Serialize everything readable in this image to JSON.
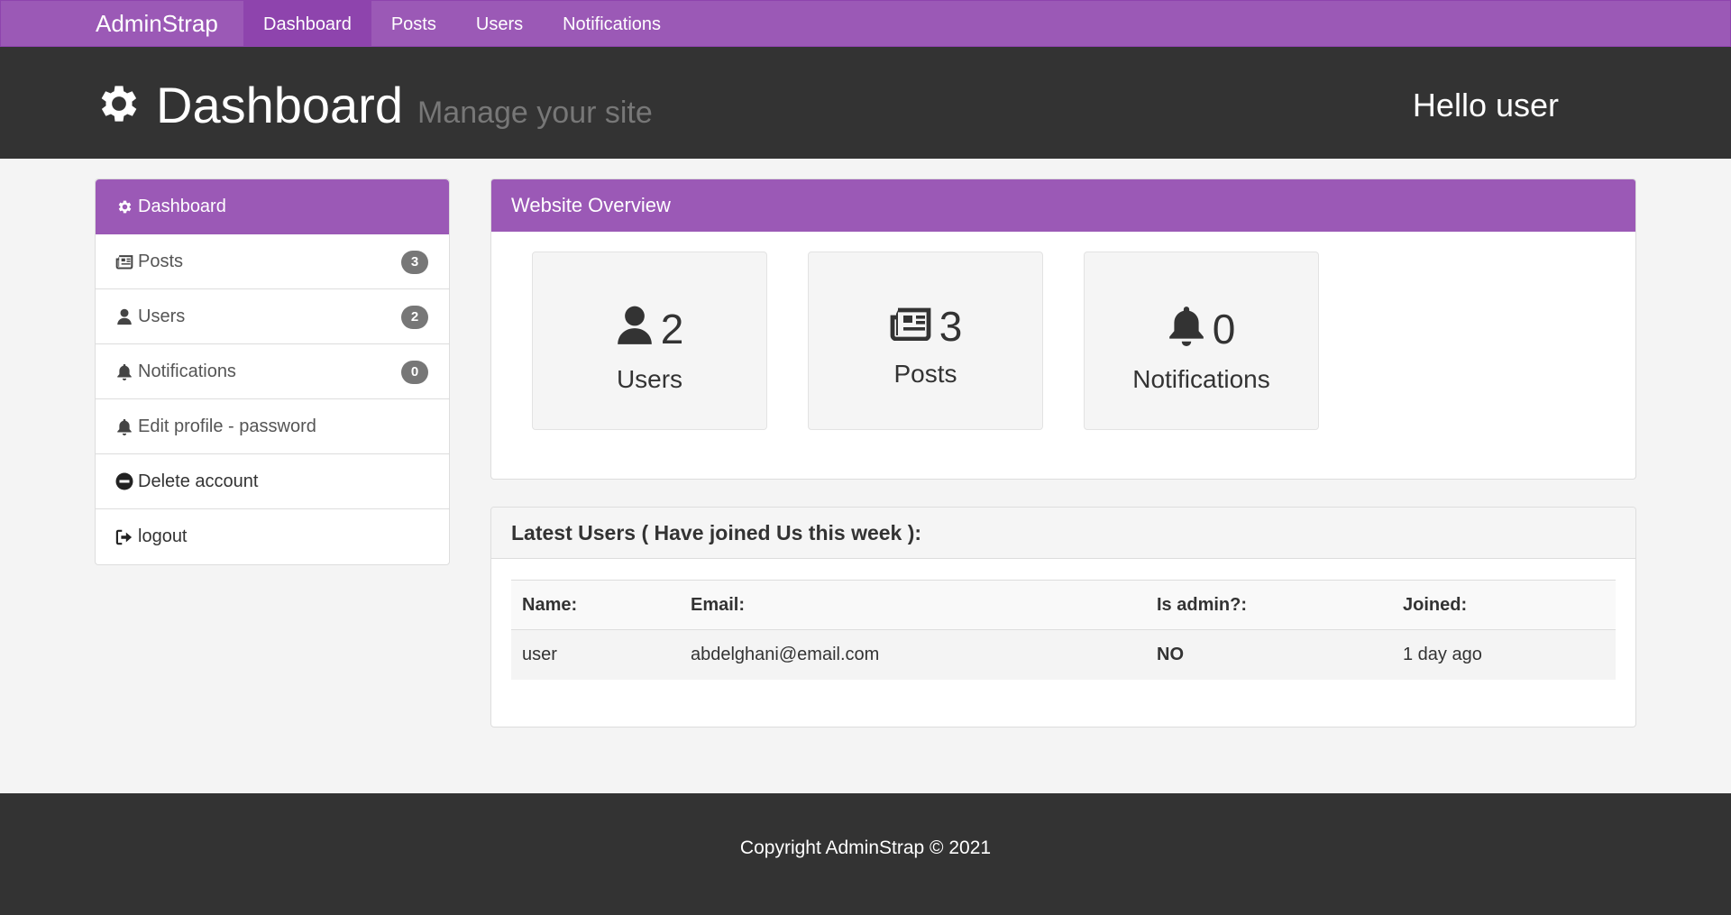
{
  "navbar": {
    "brand": "AdminStrap",
    "items": [
      {
        "label": "Dashboard",
        "active": true
      },
      {
        "label": "Posts"
      },
      {
        "label": "Users"
      },
      {
        "label": "Notifications"
      }
    ]
  },
  "header": {
    "icon": "gear-icon",
    "title": "Dashboard",
    "subtitle": "Manage your site",
    "greeting": "Hello user"
  },
  "sidebar": {
    "items": [
      {
        "label": "Dashboard",
        "icon": "gear-icon",
        "active": true
      },
      {
        "label": "Posts",
        "icon": "newspaper-icon",
        "badge": "3"
      },
      {
        "label": "Users",
        "icon": "user-icon",
        "badge": "2"
      },
      {
        "label": "Notifications",
        "icon": "bell-icon",
        "badge": "0"
      },
      {
        "label": "Edit profile - password",
        "icon": "bell-icon"
      },
      {
        "label": "Delete account",
        "icon": "minus-circle-icon"
      },
      {
        "label": "logout",
        "icon": "sign-out-icon"
      }
    ]
  },
  "overview": {
    "title": "Website Overview",
    "cards": [
      {
        "count": "2",
        "label": "Users",
        "icon": "user-icon"
      },
      {
        "count": "3",
        "label": "Posts",
        "icon": "newspaper-icon"
      },
      {
        "count": "0",
        "label": "Notifications",
        "icon": "bell-icon"
      }
    ]
  },
  "latest_users": {
    "title": "Latest Users ( Have joined Us this week ):",
    "columns": [
      "Name:",
      "Email:",
      "Is admin?:",
      "Joined:"
    ],
    "rows": [
      {
        "name": "user",
        "email": "abdelghani@email.com",
        "is_admin": "NO",
        "joined": "1 day ago"
      }
    ]
  },
  "footer": {
    "text": "Copyright AdminStrap © 2021"
  },
  "colors": {
    "primary": "#9b59b6",
    "primary_dark": "#8e44ad",
    "header_bg": "#333333",
    "page_bg": "#f4f4f4",
    "badge": "#777777"
  }
}
